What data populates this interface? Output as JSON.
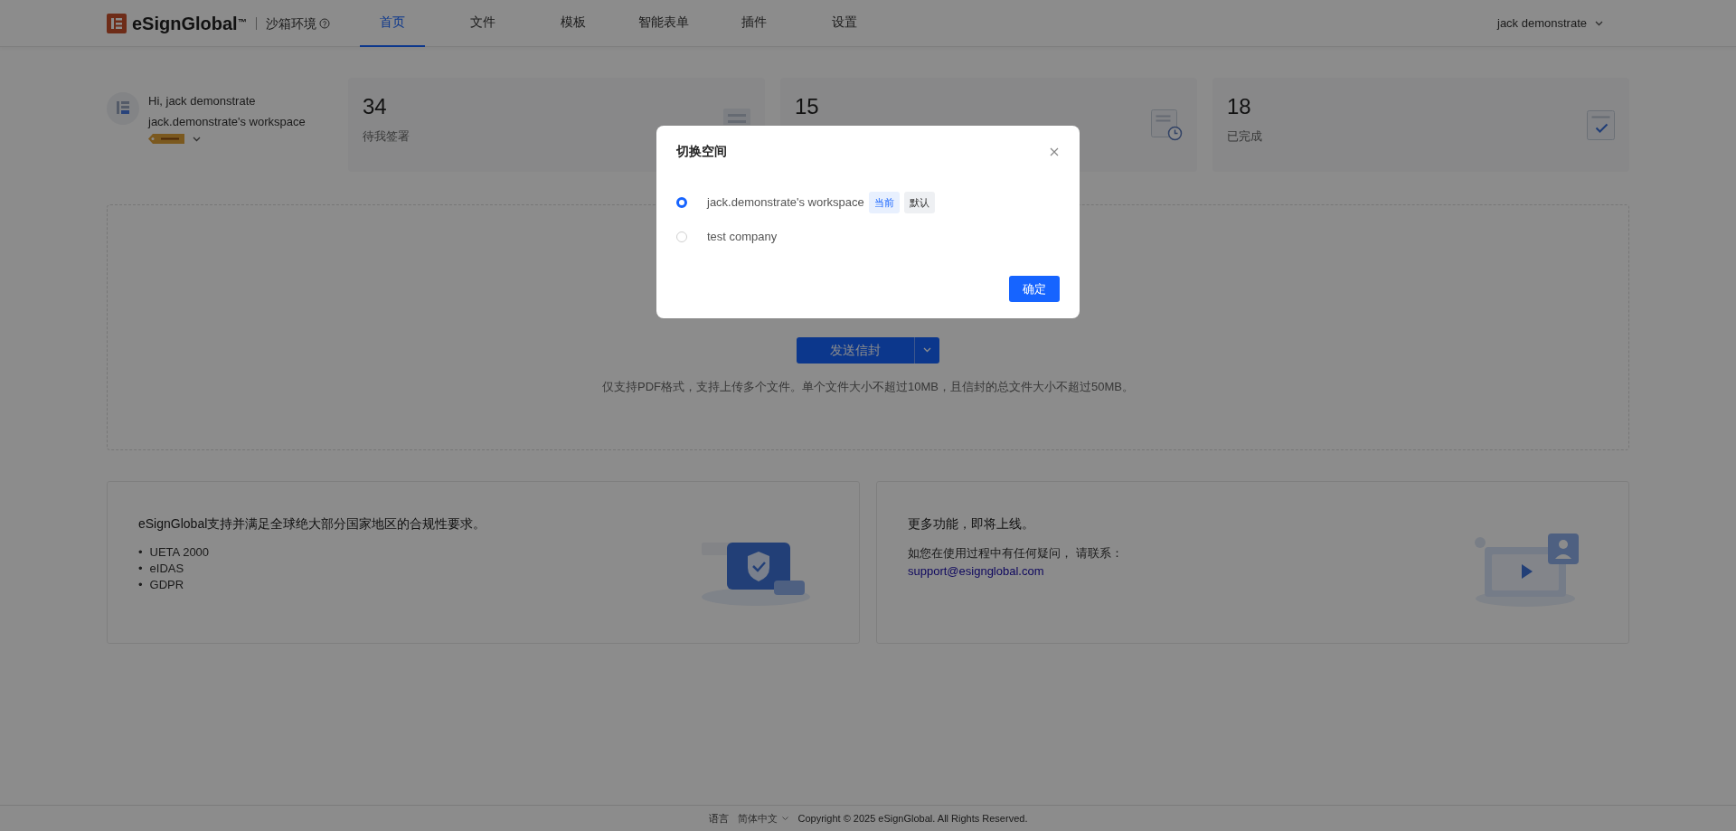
{
  "header": {
    "logo": "eSignGlobal$^{™}$",
    "env": "沙箱环境",
    "nav": [
      {
        "label": "首页",
        "selected": true
      },
      {
        "label": "文件",
        "selected": false
      },
      {
        "label": "模板",
        "selected": false
      },
      {
        "label": "智能表单",
        "selected": false
      },
      {
        "label": "插件",
        "selected": false
      },
      {
        "label": "设置",
        "selected": false
      }
    ],
    "user": "jack demonstrate"
  },
  "profile": {
    "greeting": "Hi, jack demonstrate",
    "workspace": "jack.demonstrate's workspace"
  },
  "stats": [
    {
      "count": "34",
      "label": "待我签署",
      "kind": "document"
    },
    {
      "count": "15",
      "kind": "clock"
    },
    {
      "count": "18",
      "label": "已完成",
      "kind": "check"
    }
  ],
  "upload": {
    "button": "发送信封",
    "hint": "仅支持PDF格式，支持上传多个文件。单个文件大小不超过10MB，且信封的总文件大小不超过50MB。"
  },
  "info_cards": [
    {
      "kind": "list",
      "title": "eSignGlobal支持并满足全球绝大部分国家地区的合规性要求。",
      "items": [
        {
          "marker": "•",
          "text": "UETA 2000"
        },
        {
          "marker": "•",
          "text": "eIDAS"
        },
        {
          "marker": "•",
          "text": "GDPR"
        }
      ]
    },
    {
      "kind": "contact",
      "title": "更多功能，即将上线。",
      "text": "如您在使用过程中有任何疑问， 请联系：",
      "link": "support@esignglobal.com"
    }
  ],
  "footer": {
    "language_label": "语言",
    "language": "简体中文",
    "copyright": "Copyright © 2025 eSignGlobal. All Rights Reserved."
  },
  "modal": {
    "title": "切换空间",
    "options": [
      {
        "label": "jack.demonstrate's workspace",
        "selected": true,
        "tags": [
          {
            "label": "当前",
            "kind": "current"
          },
          {
            "label": "默认",
            "kind": "default"
          }
        ]
      },
      {
        "label": "test company",
        "selected": false
      }
    ],
    "confirm": "确定"
  }
}
